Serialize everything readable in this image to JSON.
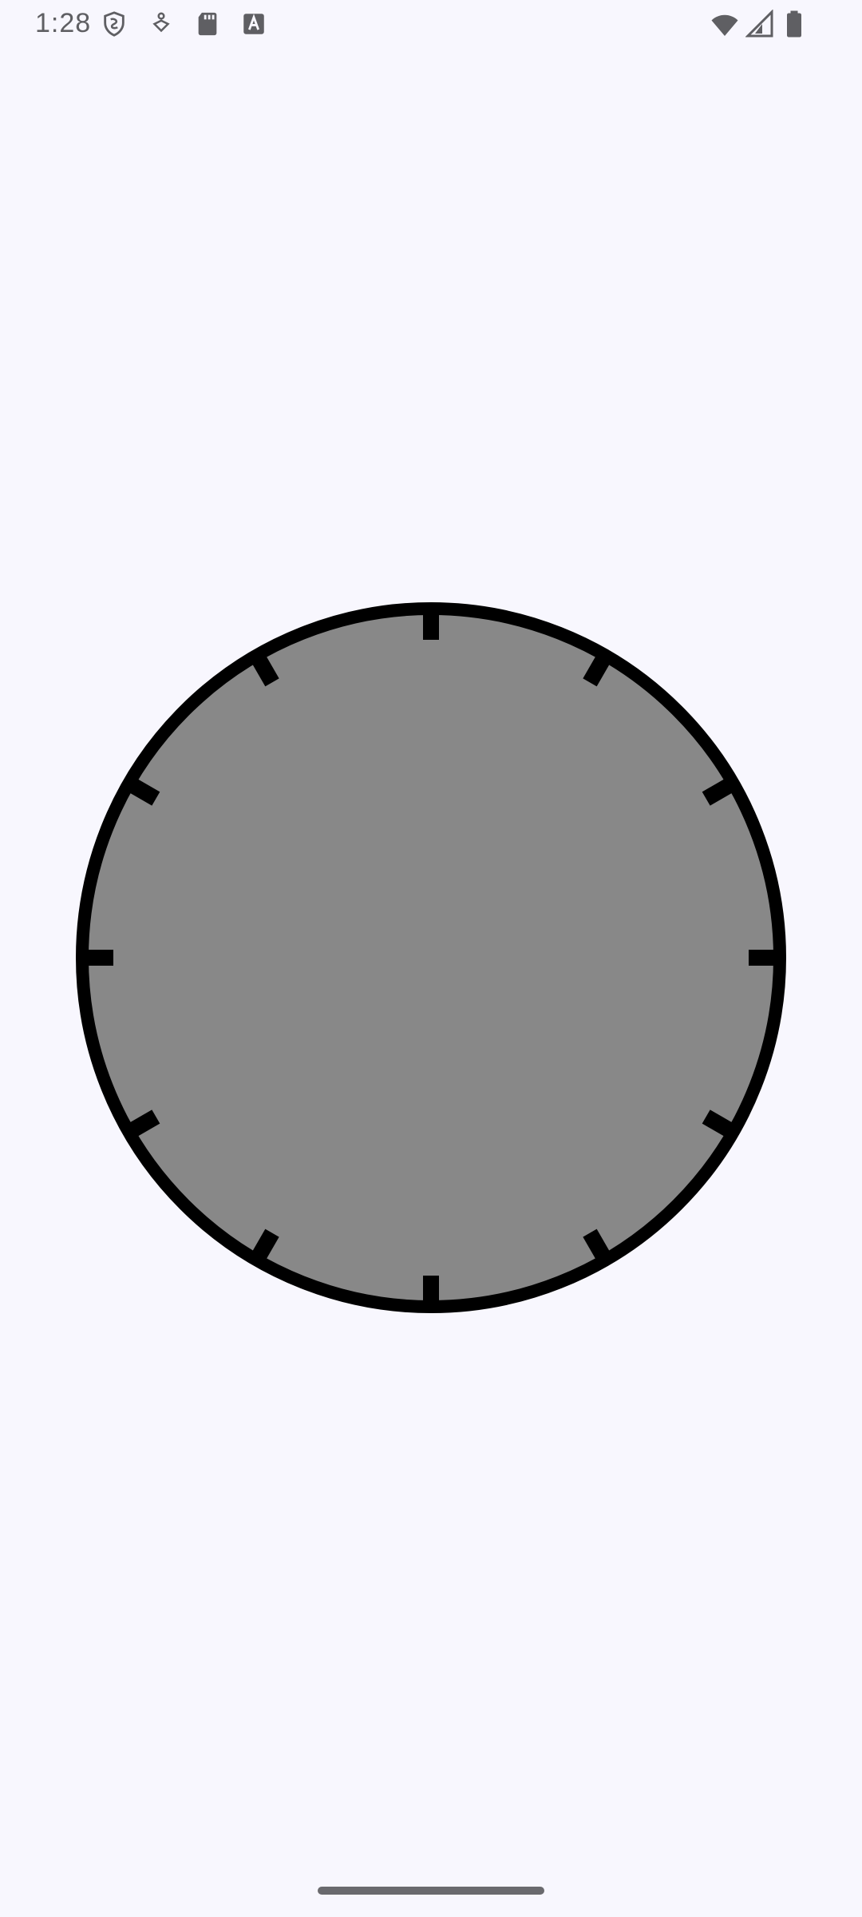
{
  "status_bar": {
    "time": "1:28",
    "left_icons": [
      "shield-icon",
      "accessibility-icon",
      "sd-card-icon",
      "font-a-icon"
    ],
    "right_icons": [
      "wifi-icon",
      "cell-signal-icon",
      "battery-icon"
    ],
    "icon_color": "#5f5f63"
  },
  "clock": {
    "face_color": "#888888",
    "rim_color": "#000000",
    "tick_count": 12,
    "background_color": "#F8F7FE"
  },
  "navigation": {
    "home_indicator_color": "#6a6a6e"
  }
}
